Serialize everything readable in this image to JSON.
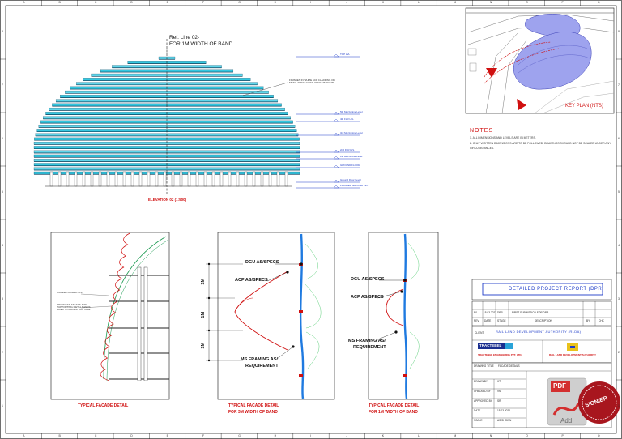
{
  "border": {
    "column_letters": [
      "A",
      "B",
      "C",
      "D",
      "E",
      "F",
      "G",
      "H",
      "I",
      "J",
      "K",
      "L",
      "M",
      "N",
      "O",
      "P",
      "Q"
    ],
    "row_numbers": [
      "8",
      "7",
      "6",
      "5",
      "4",
      "3",
      "2",
      "1"
    ]
  },
  "elevation": {
    "ref_line_title": "Ref. Line 02-",
    "ref_line_subtitle": "FOR 1M WIDTH OF BAND",
    "caption": "ELEVATION 02 (1:500)",
    "callout_note": "FINISHES IN WHITE ACP CLADDING ON METAL SHEET FIXED OVER MS FRAME",
    "level_tags": [
      "TOP LVL",
      "5th Mezzanine Level",
      "4th FLR LVL",
      "3rd Mezzanine Level",
      "2nd FLR LVL",
      "1st Mezzanine Level",
      "GROUND FLOOR",
      "Ground Floor Level",
      "FINISHED GROUND LVL"
    ]
  },
  "details": {
    "section1": {
      "caption": "TYPICAL FACADE DETAIL",
      "notes": [
        "CURVED GLAZED UNIT",
        "PROPOSED FACADE AND SUPPORTING METAL BANDS FIXED TO MAIN STRUCTURE"
      ]
    },
    "section2": {
      "caption_line1": "TYPICAL FACADE DETAIL",
      "caption_line2": "FOR 3M WIDTH OF BAND",
      "labels": [
        "DGU AS/SPECS",
        "ACP AS/SPECS",
        "MS FRAMING AS/",
        "REQUIREMENT"
      ],
      "dims": [
        "1M",
        "1M",
        "1M"
      ]
    },
    "section3": {
      "caption_line1": "TYPICAL FACADE DETAIL",
      "caption_line2": "FOR 1M WIDTH OF BAND",
      "labels": [
        "DGU AS/SPECS",
        "ACP AS/SPECS",
        "MS FRAMING AS/",
        "REQUIREMENT"
      ]
    }
  },
  "key_plan": {
    "label": "KEY PLAN (NTS)"
  },
  "notes": {
    "title": "NOTES",
    "items": [
      "1.   ALL DIMENSIONS AND LEVELS ARE IN METERS.",
      "2.   ONLY WRITTEN DIMENSIONS ARE TO BE FOLLOWED. DRAWINGS SHOULD NOT BE SCALED UNDER ANY",
      "      CIRCUMSTANCES."
    ]
  },
  "title_block": {
    "project": "DETAILED PROJECT REPORT (DPR)",
    "client_label": "CLIENT",
    "client": "RAIL LAND DEVELOPMENT AUTHORITY (RLDA)",
    "consultant_logo": "TRACTEBEL",
    "consultant_name": "TRACTEBEL ENGINEERING PVT. LTD.",
    "authority_name": "RAIL LAND DEVELOPMENT AUTHORITY",
    "revision_headers": [
      "REV",
      "DATE",
      "STAGE",
      "DESCRIPTION",
      "BY",
      "CHK"
    ],
    "revision_row": [
      "R0",
      "15.03.2022",
      "DPR",
      "FIRST SUBMISSION FOR DPR"
    ],
    "fields": [
      {
        "label": "DRAWN BY",
        "value": "KT"
      },
      {
        "label": "CHECKED BY",
        "value": "VM"
      },
      {
        "label": "APPROVED BY",
        "value": "SR"
      },
      {
        "label": "DATE",
        "value": "15.03.2022"
      },
      {
        "label": "SCALE",
        "value": "AS SHOWN"
      }
    ],
    "drawing_title_label": "DRAWING TITLE",
    "drawing_title": "FACADE DETAILS"
  },
  "watermark": {
    "pdf_word": "PDF",
    "editor_text": "Add",
    "seal_text": "SIONIER"
  },
  "colors": {
    "dome_cyan": "#34c8e0",
    "dome_dark": "#0a3f5a",
    "accent_red": "#d01010",
    "accent_blue": "#1e3cc8",
    "glass_blue": "#1f7ae0"
  }
}
